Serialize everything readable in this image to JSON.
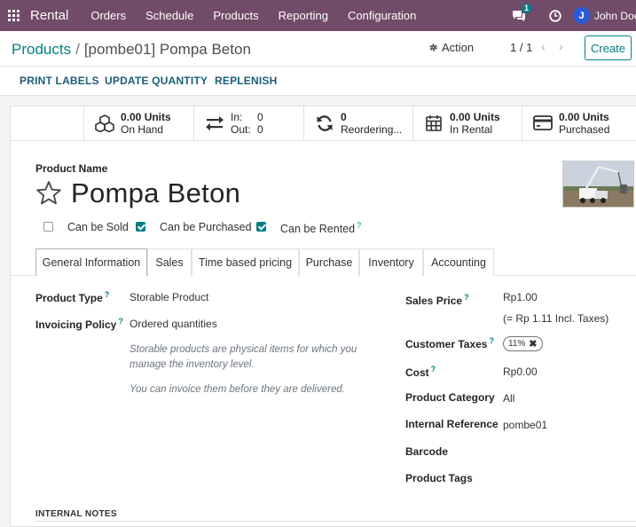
{
  "navbar": {
    "app_name": "Rental",
    "menu": [
      "Orders",
      "Schedule",
      "Products",
      "Reporting",
      "Configuration"
    ],
    "chat_badge": "1",
    "user_initial": "J",
    "user_name": "John Doe"
  },
  "breadcrumb": {
    "parent": "Products",
    "separator": "/",
    "current": "[pombe01] Pompa Beton"
  },
  "control": {
    "action_label": "Action",
    "pager": "1 / 1",
    "create_label": "Create"
  },
  "header_buttons": {
    "print_labels": "PRINT LABELS",
    "update_quantity": "UPDATE QUANTITY",
    "replenish": "REPLENISH"
  },
  "smart_buttons": {
    "on_hand_value": "0.00 Units",
    "on_hand_label": "On Hand",
    "in_label": "In:",
    "in_value": "0",
    "out_label": "Out:",
    "out_value": "0",
    "reordering_value": "0",
    "reordering_label": "Reordering...",
    "in_rental_value": "0.00 Units",
    "in_rental_label": "In Rental",
    "purchased_value": "0.00 Units",
    "purchased_label": "Purchased"
  },
  "form": {
    "product_name_label": "Product Name",
    "product_name": "Pompa Beton",
    "can_be_sold": "Can be Sold",
    "can_be_purchased": "Can be Purchased",
    "can_be_rented": "Can be Rented",
    "help_mark": "?"
  },
  "tabs": [
    "General Information",
    "Sales",
    "Time based pricing",
    "Purchase",
    "Inventory",
    "Accounting"
  ],
  "general": {
    "product_type_label": "Product Type",
    "product_type": "Storable Product",
    "invoicing_policy_label": "Invoicing Policy",
    "invoicing_policy": "Ordered quantities",
    "note1_line1": "Storable products are physical items for which you",
    "note1_line2": "manage the inventory level.",
    "note2": "You can invoice them before they are delivered.",
    "sales_price_label": "Sales Price",
    "sales_price": "Rp1.00",
    "sales_price_incl": "(= Rp 1.11 Incl. Taxes)",
    "customer_taxes_label": "Customer Taxes",
    "customer_tax_tag": "11%",
    "cost_label": "Cost",
    "cost": "Rp0.00",
    "product_category_label": "Product Category",
    "product_category": "All",
    "internal_reference_label": "Internal Reference",
    "internal_reference": "pombe01",
    "barcode_label": "Barcode",
    "product_tags_label": "Product Tags",
    "internal_notes_label": "INTERNAL NOTES"
  },
  "colors": {
    "navbar": "#714b67",
    "accent": "#017e84",
    "avatar": "#2a5bd7"
  }
}
